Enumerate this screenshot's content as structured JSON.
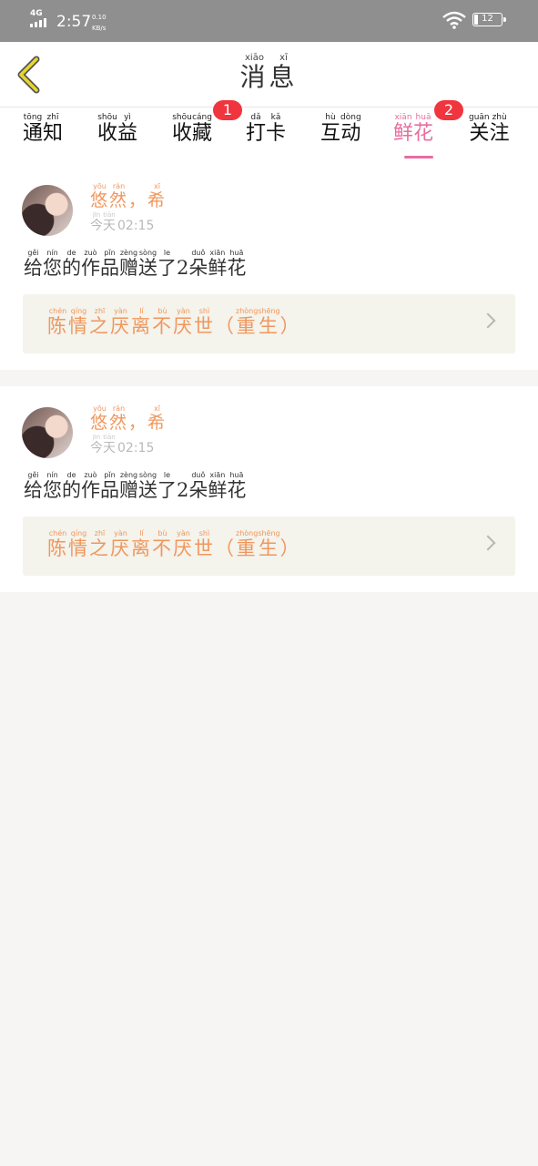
{
  "status_bar": {
    "network": "4G",
    "time": "2:57",
    "speed_value": "0.10",
    "speed_unit": "KB/s",
    "battery": "12"
  },
  "header": {
    "title": [
      {
        "char": "消",
        "pinyin": "xiāo"
      },
      {
        "char": "息",
        "pinyin": "xī"
      }
    ]
  },
  "tabs": [
    {
      "chars": [
        {
          "char": "通",
          "pinyin": "tōng"
        },
        {
          "char": "知",
          "pinyin": "zhī"
        }
      ],
      "badge": "",
      "active": false
    },
    {
      "chars": [
        {
          "char": "收",
          "pinyin": "shōu"
        },
        {
          "char": "益",
          "pinyin": "yì"
        }
      ],
      "badge": "",
      "active": false
    },
    {
      "chars": [
        {
          "char": "收",
          "pinyin": "shōu"
        },
        {
          "char": "藏",
          "pinyin": "cáng"
        }
      ],
      "badge": "1",
      "active": false
    },
    {
      "chars": [
        {
          "char": "打",
          "pinyin": "dǎ"
        },
        {
          "char": "卡",
          "pinyin": "kǎ"
        }
      ],
      "badge": "",
      "active": false
    },
    {
      "chars": [
        {
          "char": "互",
          "pinyin": "hù"
        },
        {
          "char": "动",
          "pinyin": "dòng"
        }
      ],
      "badge": "",
      "active": false
    },
    {
      "chars": [
        {
          "char": "鲜",
          "pinyin": "xiān"
        },
        {
          "char": "花",
          "pinyin": "huā"
        }
      ],
      "badge": "2",
      "active": true
    },
    {
      "chars": [
        {
          "char": "关",
          "pinyin": "guān"
        },
        {
          "char": "注",
          "pinyin": "zhù"
        }
      ],
      "badge": "",
      "active": false
    }
  ],
  "colors": {
    "accent_pink": "#e86d9f",
    "orange_text": "#f0975d",
    "badge_red": "#f0353f",
    "status_bar": "#8f8f8f",
    "work_bg": "#f4f3ec"
  },
  "messages": [
    {
      "username": [
        {
          "char": "悠",
          "pinyin": "yōu"
        },
        {
          "char": "然",
          "pinyin": "rán"
        },
        {
          "char": "，",
          "pinyin": ""
        },
        {
          "char": "希",
          "pinyin": "xī"
        }
      ],
      "time_label": [
        {
          "char": "今",
          "pinyin": "jīn"
        },
        {
          "char": "天",
          "pinyin": "tiān"
        }
      ],
      "time_value": "02:15",
      "text": [
        {
          "char": "给",
          "pinyin": "gěi"
        },
        {
          "char": "您",
          "pinyin": "nín"
        },
        {
          "char": "的",
          "pinyin": "de"
        },
        {
          "char": "作",
          "pinyin": "zuò"
        },
        {
          "char": "品",
          "pinyin": "pǐn"
        },
        {
          "char": "赠",
          "pinyin": "zèng"
        },
        {
          "char": "送",
          "pinyin": "sòng"
        },
        {
          "char": "了",
          "pinyin": "le"
        },
        {
          "char": "2",
          "pinyin": ""
        },
        {
          "char": "朵",
          "pinyin": "duǒ"
        },
        {
          "char": "鲜",
          "pinyin": "xiān"
        },
        {
          "char": "花",
          "pinyin": "huā"
        }
      ],
      "work_title": [
        {
          "char": "陈",
          "pinyin": "chén"
        },
        {
          "char": "情",
          "pinyin": "qíng"
        },
        {
          "char": "之",
          "pinyin": "zhī"
        },
        {
          "char": "厌",
          "pinyin": "yàn"
        },
        {
          "char": "离",
          "pinyin": "lí"
        },
        {
          "char": "不",
          "pinyin": "bù"
        },
        {
          "char": "厌",
          "pinyin": "yàn"
        },
        {
          "char": "世",
          "pinyin": "shì"
        },
        {
          "char": "（",
          "pinyin": ""
        },
        {
          "char": "重",
          "pinyin": "zhòng"
        },
        {
          "char": "生",
          "pinyin": "shēng"
        },
        {
          "char": "）",
          "pinyin": ""
        }
      ]
    },
    {
      "username": [
        {
          "char": "悠",
          "pinyin": "yōu"
        },
        {
          "char": "然",
          "pinyin": "rán"
        },
        {
          "char": "，",
          "pinyin": ""
        },
        {
          "char": "希",
          "pinyin": "xī"
        }
      ],
      "time_label": [
        {
          "char": "今",
          "pinyin": "jīn"
        },
        {
          "char": "天",
          "pinyin": "tiān"
        }
      ],
      "time_value": "02:15",
      "text": [
        {
          "char": "给",
          "pinyin": "gěi"
        },
        {
          "char": "您",
          "pinyin": "nín"
        },
        {
          "char": "的",
          "pinyin": "de"
        },
        {
          "char": "作",
          "pinyin": "zuò"
        },
        {
          "char": "品",
          "pinyin": "pǐn"
        },
        {
          "char": "赠",
          "pinyin": "zèng"
        },
        {
          "char": "送",
          "pinyin": "sòng"
        },
        {
          "char": "了",
          "pinyin": "le"
        },
        {
          "char": "2",
          "pinyin": ""
        },
        {
          "char": "朵",
          "pinyin": "duǒ"
        },
        {
          "char": "鲜",
          "pinyin": "xiān"
        },
        {
          "char": "花",
          "pinyin": "huā"
        }
      ],
      "work_title": [
        {
          "char": "陈",
          "pinyin": "chén"
        },
        {
          "char": "情",
          "pinyin": "qíng"
        },
        {
          "char": "之",
          "pinyin": "zhī"
        },
        {
          "char": "厌",
          "pinyin": "yàn"
        },
        {
          "char": "离",
          "pinyin": "lí"
        },
        {
          "char": "不",
          "pinyin": "bù"
        },
        {
          "char": "厌",
          "pinyin": "yàn"
        },
        {
          "char": "世",
          "pinyin": "shì"
        },
        {
          "char": "（",
          "pinyin": ""
        },
        {
          "char": "重",
          "pinyin": "zhòng"
        },
        {
          "char": "生",
          "pinyin": "shēng"
        },
        {
          "char": "）",
          "pinyin": ""
        }
      ]
    }
  ]
}
